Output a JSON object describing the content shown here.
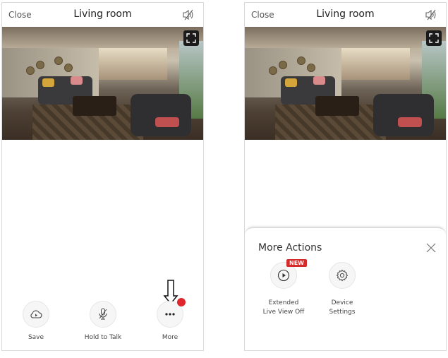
{
  "left_screen": {
    "header": {
      "close_label": "Close",
      "title": "Living room",
      "mute_icon": "speaker-muted-icon"
    },
    "video": {
      "fullscreen_icon": "fullscreen-icon"
    },
    "actions": [
      {
        "label": "Save",
        "icon": "cloud-play-icon"
      },
      {
        "label": "Hold to Talk",
        "icon": "microphone-muted-icon"
      },
      {
        "label": "More",
        "icon": "more-dots-icon",
        "notification": true
      }
    ],
    "annotation_arrow": "down-arrow-icon"
  },
  "right_screen": {
    "header": {
      "close_label": "Close",
      "title": "Living room",
      "mute_icon": "speaker-muted-icon"
    },
    "video": {
      "fullscreen_icon": "fullscreen-icon"
    },
    "sheet": {
      "title": "More Actions",
      "close_icon": "close-icon",
      "actions": [
        {
          "label": "Extended\nLive View Off",
          "icon": "play-circle-icon",
          "badge": "NEW"
        },
        {
          "label": "Device\nSettings",
          "icon": "gear-icon"
        }
      ]
    }
  },
  "colors": {
    "badge_red": "#e0262d",
    "new_badge_red": "#d42a2a",
    "text_dark": "#222222",
    "text_muted": "#555555"
  }
}
